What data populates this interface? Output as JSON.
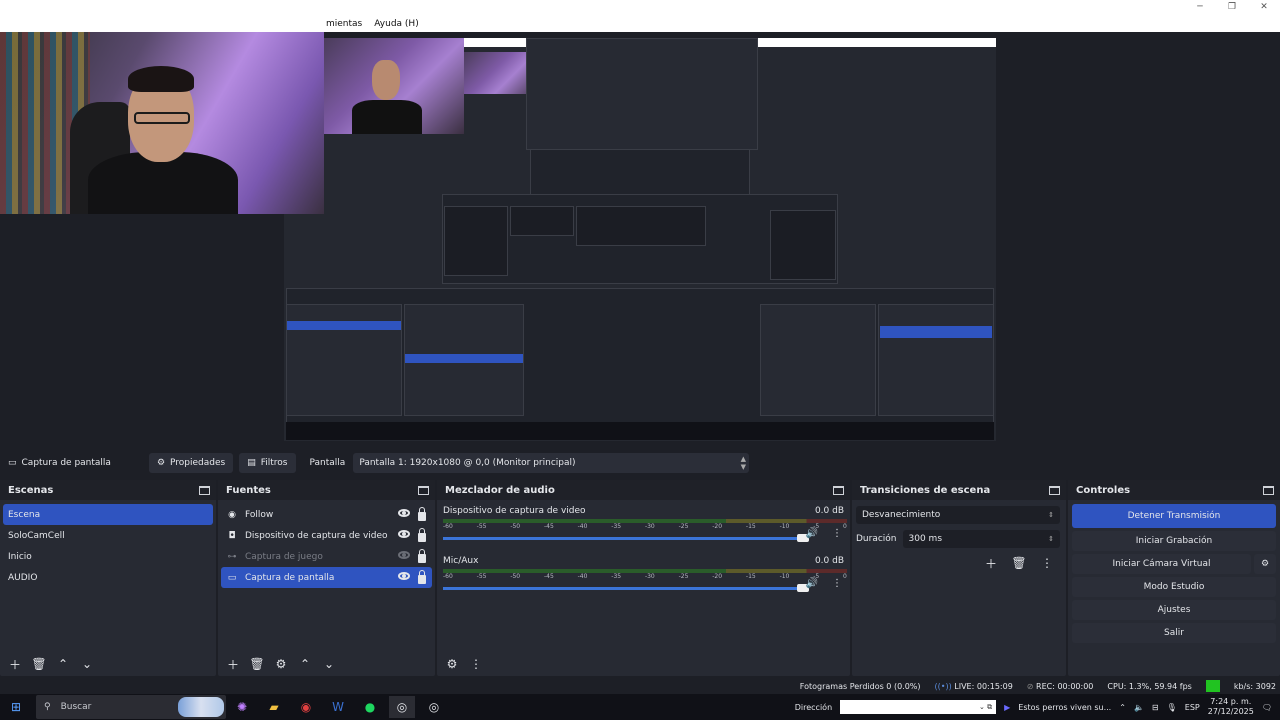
{
  "menu": [
    "mientas",
    "Ayuda (H)"
  ],
  "window_buttons": [
    "─",
    "❐",
    "✕"
  ],
  "source_toolbar": {
    "source_name": "Captura de pantalla",
    "properties_label": "Propiedades",
    "filters_label": "Filtros",
    "display_label": "Pantalla",
    "display_value": "Pantalla 1: 1920x1080 @ 0,0 (Monitor principal)"
  },
  "scenes": {
    "title": "Escenas",
    "items": [
      "Escena",
      "SoloCamCell",
      "Inicio",
      "AUDIO"
    ],
    "selected": 0
  },
  "sources": {
    "title": "Fuentes",
    "items": [
      {
        "label": "Follow",
        "icon": "browser-icon",
        "visible": true,
        "dim": false
      },
      {
        "label": "Dispositivo de captura de video",
        "icon": "camera-icon",
        "visible": true,
        "dim": false
      },
      {
        "label": "Captura de juego",
        "icon": "gamepad-icon",
        "visible": false,
        "dim": true
      },
      {
        "label": "Captura de pantalla",
        "icon": "monitor-icon",
        "visible": true,
        "dim": false
      }
    ],
    "selected": 3
  },
  "mixer": {
    "title": "Mezclador de audio",
    "scale": [
      "-60",
      "-55",
      "-50",
      "-45",
      "-40",
      "-35",
      "-30",
      "-25",
      "-20",
      "-15",
      "-10",
      "-5",
      "0"
    ],
    "channels": [
      {
        "name": "Dispositivo de captura de video",
        "db": "0.0 dB",
        "volume": 1.0
      },
      {
        "name": "Mic/Aux",
        "db": "0.0 dB",
        "volume": 1.0
      }
    ]
  },
  "transitions": {
    "title": "Transiciones de escena",
    "type": "Desvanecimiento",
    "duration_label": "Duración",
    "duration_value": "300 ms"
  },
  "controls": {
    "title": "Controles",
    "stop_stream": "Detener Transmisión",
    "start_record": "Iniciar Grabación",
    "virtual_cam": "Iniciar Cámara Virtual",
    "studio_mode": "Modo Estudio",
    "settings": "Ajustes",
    "exit": "Salir"
  },
  "status": {
    "dropped": "Fotogramas Perdidos 0 (0.0%)",
    "live": "LIVE: 00:15:09",
    "rec": "REC: 00:00:00",
    "cpu": "CPU: 1.3%, 59.94 fps",
    "kbps": "kb/s: 3092"
  },
  "taskbar": {
    "search_placeholder": "Buscar",
    "address_label": "Dirección",
    "media_text": "Estos perros viven su...",
    "lang": "ESP",
    "time": "7:24 p. m.",
    "date": "27/12/2025"
  },
  "colors": {
    "accent": "#2f54c0",
    "panel": "#272a33",
    "background": "#1d1f26",
    "status_green": "#21c321"
  }
}
